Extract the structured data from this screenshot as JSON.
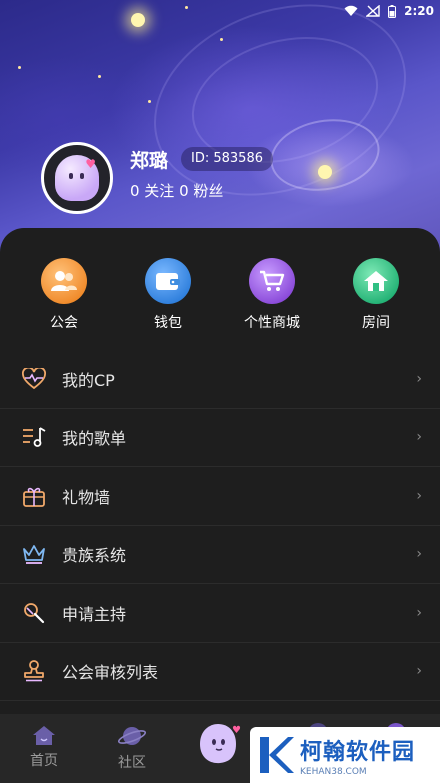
{
  "status_bar": {
    "time": "2:20"
  },
  "profile": {
    "username": "郑璐",
    "id_text": "ID: 583586",
    "follow_text": "0 关注  0 粉丝"
  },
  "quick_actions": [
    {
      "label": "公会",
      "icon": "guild-icon",
      "color": "#f29a3a"
    },
    {
      "label": "钱包",
      "icon": "wallet-icon",
      "color": "#3f8de0"
    },
    {
      "label": "个性商城",
      "icon": "shop-cart-icon",
      "color": "#9b5ce0"
    },
    {
      "label": "房间",
      "icon": "house-icon",
      "color": "#2fbf83"
    }
  ],
  "menu": [
    {
      "label": "我的CP",
      "icon": "heart-pulse-icon"
    },
    {
      "label": "我的歌单",
      "icon": "playlist-icon"
    },
    {
      "label": "礼物墙",
      "icon": "gift-icon"
    },
    {
      "label": "贵族系统",
      "icon": "crown-icon"
    },
    {
      "label": "申请主持",
      "icon": "microphone-icon"
    },
    {
      "label": "公会审核列表",
      "icon": "stamp-icon"
    }
  ],
  "bottom_nav": [
    {
      "label": "首页",
      "icon": "home-icon"
    },
    {
      "label": "社区",
      "icon": "planet-icon"
    }
  ],
  "watermark": {
    "title": "柯翰软件园",
    "url": "KEHAN38.COM"
  },
  "colors": {
    "background": "#1e1e1e",
    "hero": "#3d3aa8"
  }
}
